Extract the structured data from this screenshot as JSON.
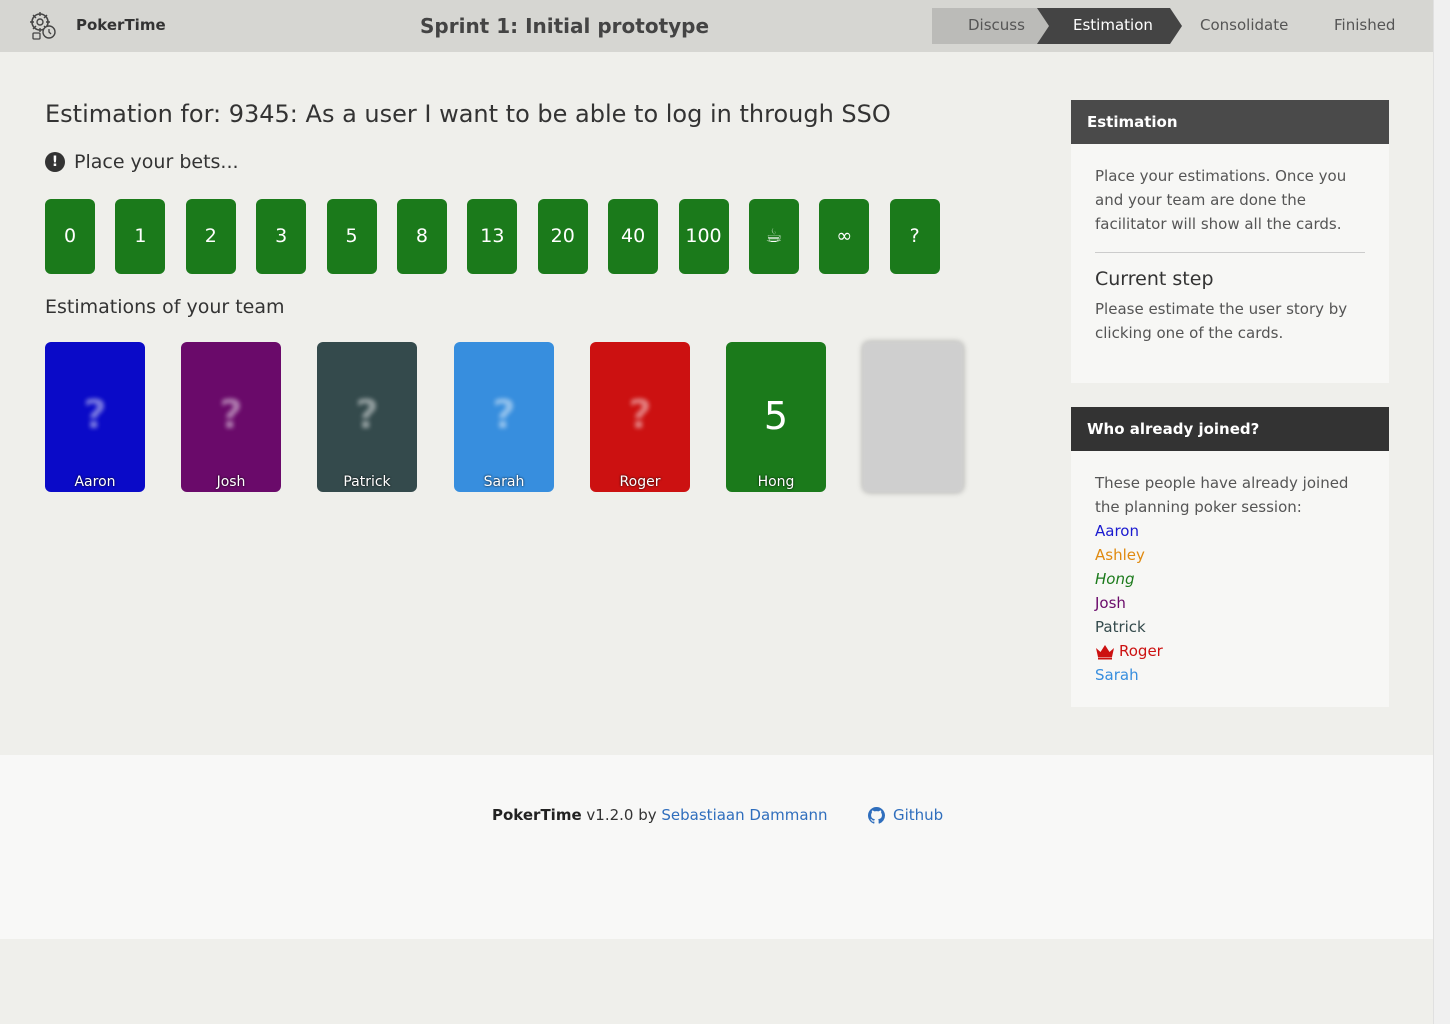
{
  "header": {
    "brand": "PokerTime",
    "sprint_title": "Sprint 1: Initial prototype",
    "steps": [
      "Discuss",
      "Estimation",
      "Consolidate",
      "Finished"
    ],
    "active_step": "Estimation"
  },
  "main": {
    "title": "Estimation for: 9345: As a user I want to be able to log in through SSO",
    "bets_label": "Place your bets...",
    "bets_icon": "exclamation-circle-icon",
    "cards": [
      "0",
      "1",
      "2",
      "3",
      "5",
      "8",
      "13",
      "20",
      "40",
      "100",
      "☕",
      "∞",
      "?"
    ],
    "card_color": "#1b7a1b",
    "team_title": "Estimations of your team",
    "team": [
      {
        "name": "Aaron",
        "color": "#0a0ac8",
        "value": "?",
        "revealed": false
      },
      {
        "name": "Josh",
        "color": "#6a0a6a",
        "value": "?",
        "revealed": false
      },
      {
        "name": "Patrick",
        "color": "#344a4c",
        "value": "?",
        "revealed": false
      },
      {
        "name": "Sarah",
        "color": "#378ede",
        "value": "?",
        "revealed": false
      },
      {
        "name": "Roger",
        "color": "#cc1111",
        "value": "?",
        "revealed": false
      },
      {
        "name": "Hong",
        "color": "#1b7a1b",
        "value": "5",
        "revealed": true
      }
    ]
  },
  "sidebar": {
    "estimation_panel": {
      "title": "Estimation",
      "text": "Place your estimations. Once you and your team are done the facilitator will show all the cards.",
      "current_step_title": "Current step",
      "current_step_text": "Please estimate the user story by clicking one of the cards."
    },
    "joined_panel": {
      "title": "Who already joined?",
      "text": "These people have already joined the planning poker session:",
      "people": [
        {
          "name": "Aaron",
          "color": "#1a1ad0",
          "italic": false,
          "facilitator": false
        },
        {
          "name": "Ashley",
          "color": "#e08a10",
          "italic": false,
          "facilitator": false
        },
        {
          "name": "Hong",
          "color": "#1b7a1b",
          "italic": true,
          "facilitator": false
        },
        {
          "name": "Josh",
          "color": "#6a0a6a",
          "italic": false,
          "facilitator": false
        },
        {
          "name": "Patrick",
          "color": "#344a4c",
          "italic": false,
          "facilitator": false
        },
        {
          "name": "Roger",
          "color": "#cc1111",
          "italic": false,
          "facilitator": true
        },
        {
          "name": "Sarah",
          "color": "#378ede",
          "italic": false,
          "facilitator": false
        }
      ]
    }
  },
  "footer": {
    "brand": "PokerTime",
    "version": "v1.2.0 by",
    "author": "Sebastiaan Dammann",
    "github_label": "Github"
  }
}
